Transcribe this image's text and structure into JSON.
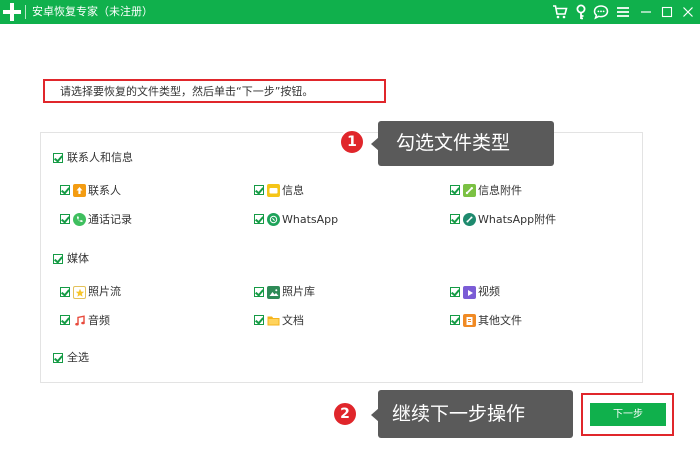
{
  "window": {
    "title": "安卓恢复专家（未注册）",
    "icons": [
      "cart-icon",
      "key-icon",
      "chat-icon",
      "menu-icon",
      "minimize-icon",
      "maximize-icon",
      "close-icon"
    ]
  },
  "instruction": "请选择要恢复的文件类型，然后单击“下一步”按钮。",
  "groups": [
    {
      "label": "联系人和信息",
      "items": [
        {
          "label": "联系人",
          "icon": "contact-icon",
          "color": "#f39c12"
        },
        {
          "label": "信息",
          "icon": "message-icon",
          "color": "#f5c518"
        },
        {
          "label": "信息附件",
          "icon": "attachment-icon",
          "color": "#7bc143"
        },
        {
          "label": "通话记录",
          "icon": "phone-icon",
          "color": "#3fbf5f"
        },
        {
          "label": "WhatsApp",
          "icon": "whatsapp-icon",
          "color": "#1ea35a"
        },
        {
          "label": "WhatsApp附件",
          "icon": "whatsapp-attachment-icon",
          "color": "#1e8a6e"
        }
      ]
    },
    {
      "label": "媒体",
      "items": [
        {
          "label": "照片流",
          "icon": "photostream-icon",
          "color": "#f7c52b"
        },
        {
          "label": "照片库",
          "icon": "photolibrary-icon",
          "color": "#2e8b57"
        },
        {
          "label": "视频",
          "icon": "video-icon",
          "color": "#7b5cd6"
        },
        {
          "label": "音频",
          "icon": "audio-icon",
          "color": "#e84a3c"
        },
        {
          "label": "文档",
          "icon": "folder-icon",
          "color": "#f5b31b"
        },
        {
          "label": "其他文件",
          "icon": "other-file-icon",
          "color": "#f08a24"
        }
      ]
    }
  ],
  "select_all": "全选",
  "callout1": {
    "number": "1",
    "text": "勾选文件类型"
  },
  "callout2": {
    "number": "2",
    "text": "继续下一步操作"
  },
  "next_button": "下一步",
  "colors": {
    "brand_green": "#10b04c",
    "highlight_red": "#e0262b",
    "callout_gray": "#5a5a5a"
  }
}
